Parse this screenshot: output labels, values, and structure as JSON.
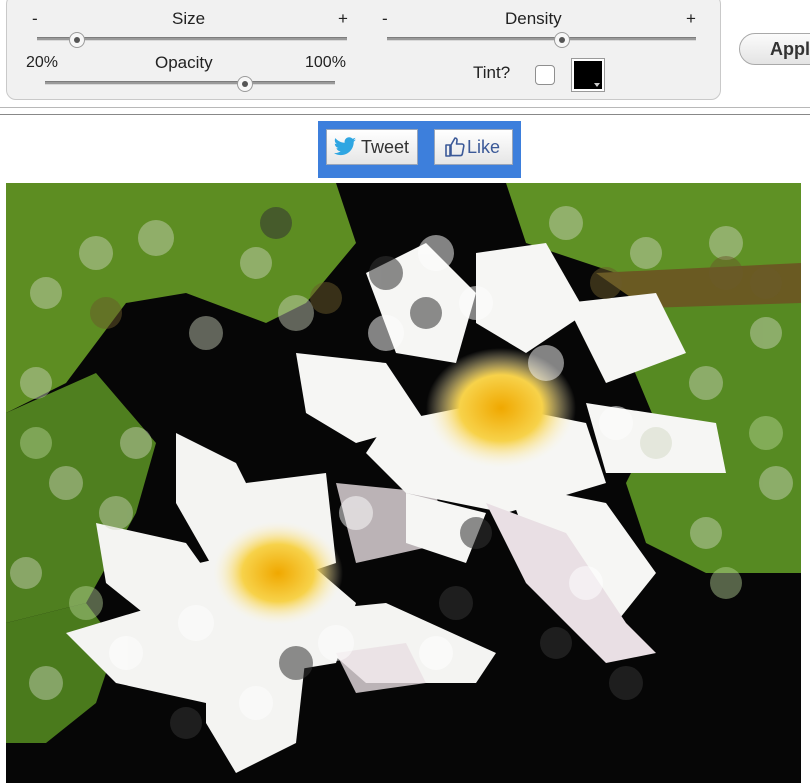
{
  "controls": {
    "size": {
      "label": "Size",
      "minus": "-",
      "plus": "+",
      "level": 0.09
    },
    "density": {
      "label": "Density",
      "minus": "-",
      "plus": "+",
      "level": 0.57
    },
    "opacity": {
      "label": "Opacity",
      "min_label": "20%",
      "max_label": "100%",
      "level": 0.69
    },
    "tint": {
      "label": "Tint?",
      "checked": false,
      "color": "#000000"
    }
  },
  "apply_button": {
    "label": "Apply"
  },
  "social": {
    "tweet_label": "Tweet",
    "like_label": "Like",
    "bar_color": "#3d7fdc"
  },
  "photo": {
    "subject": "two white water lilies on green lily pads, bokeh dot effect"
  }
}
